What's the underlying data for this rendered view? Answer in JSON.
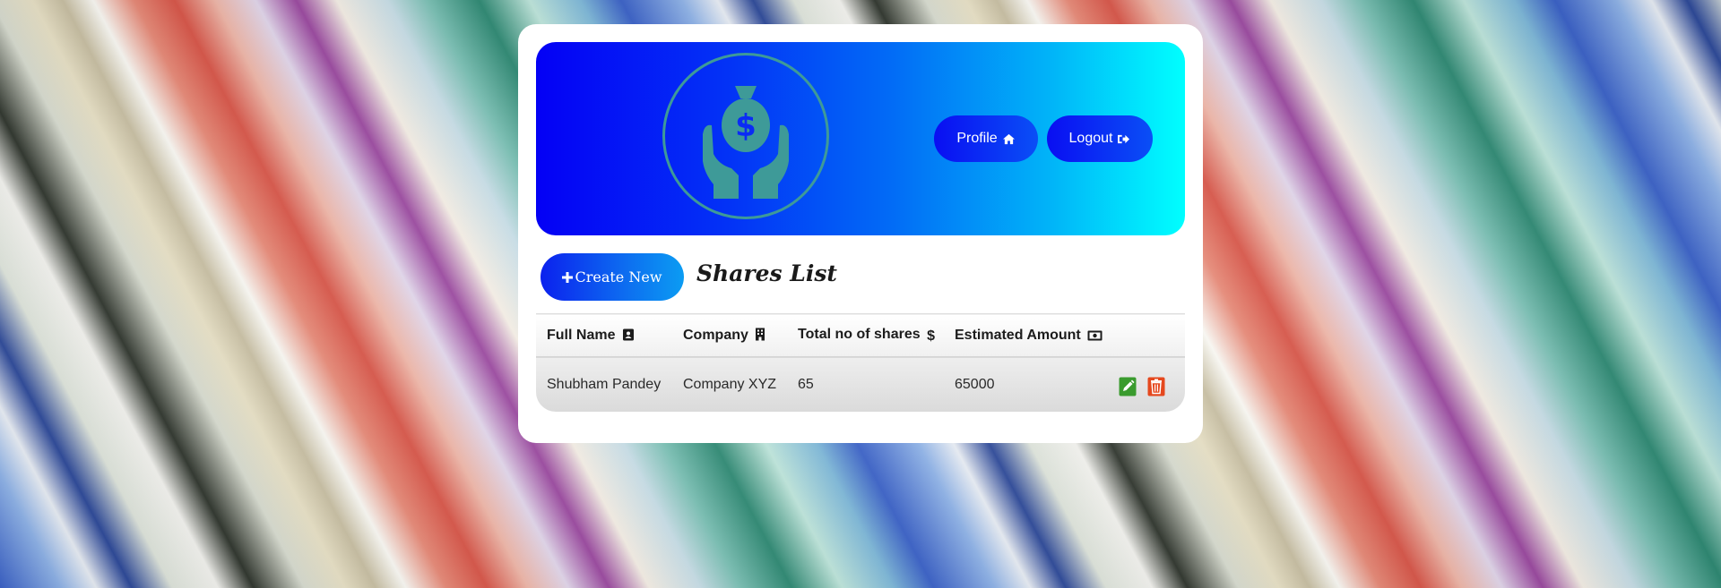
{
  "colors": {
    "banner_start": "#0400f5",
    "banner_end": "#00ffff",
    "pill": "#0a0ef2",
    "logo_teal": "#3e9a98",
    "edit_green": "#3a9b2e",
    "delete_orange": "#e5481e"
  },
  "header": {
    "logo_icon": "money-bag-hands-icon",
    "profile_label": "Profile",
    "profile_icon": "home-icon",
    "logout_label": "Logout",
    "logout_icon": "sign-out-icon"
  },
  "toolbar": {
    "create_icon": "plus-icon",
    "create_label": "Create New",
    "title": "Shares List"
  },
  "table": {
    "columns": [
      {
        "label": "Full Name",
        "icon": "address-card-icon"
      },
      {
        "label": "Company",
        "icon": "building-icon"
      },
      {
        "label": "Total no of shares",
        "icon": "dollar-icon"
      },
      {
        "label": "Estimated Amount",
        "icon": "money-bill-icon"
      }
    ],
    "rows": [
      {
        "full_name": "Shubham Pandey",
        "company": "Company XYZ",
        "shares": "65",
        "amount": "65000"
      }
    ]
  }
}
